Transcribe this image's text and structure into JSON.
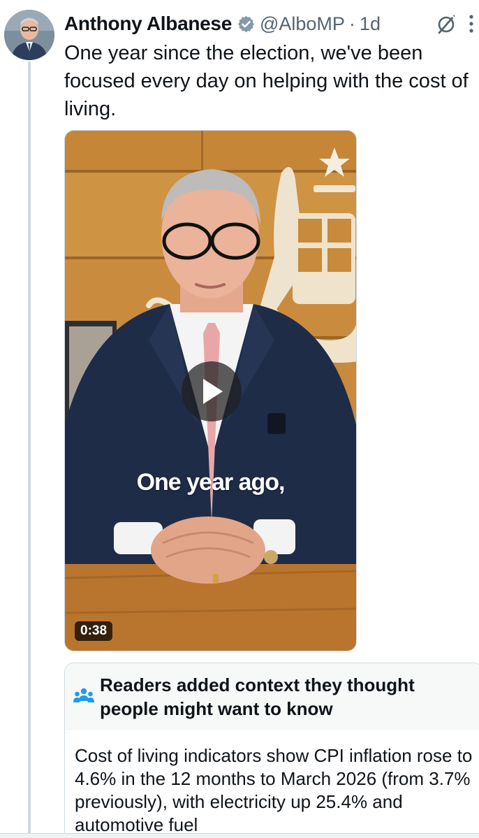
{
  "tweet": {
    "author_name": "Anthony Albanese",
    "handle": "@AlboMP",
    "separator": "·",
    "time": "1d",
    "text": "One year since the election, we've been focused every day on helping with the cost of living.",
    "icons": [
      "verified-badge-icon",
      "grok-icon",
      "more-icon"
    ]
  },
  "video": {
    "caption": "One year ago,",
    "duration": "0:38",
    "icon": "play-icon"
  },
  "community_note": {
    "title": "Readers added context they thought people might want to know",
    "body": "Cost of living indicators show CPI inflation rose to 4.6% in the 12 months to March 2026 (from 3.7% previously), with electricity up 25.4% and automotive fuel",
    "icon": "people-icon"
  },
  "colors": {
    "text_primary": "#0f1419",
    "text_secondary": "#536471",
    "verified_badge": "#829aab",
    "note_header_bg": "#f7f9f9",
    "border": "#cfd9de"
  }
}
